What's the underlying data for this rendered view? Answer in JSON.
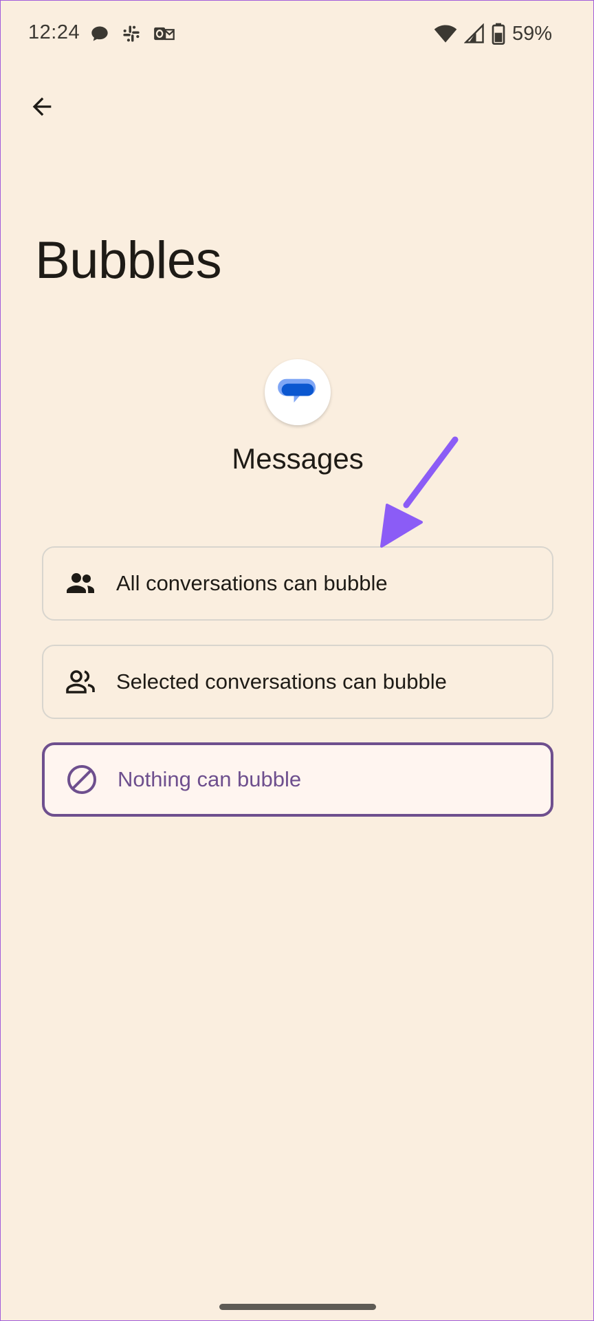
{
  "status_bar": {
    "time": "12:24",
    "battery": "59%",
    "icons": [
      "chat-notification-icon",
      "slack-icon",
      "outlook-icon",
      "wifi-icon",
      "cell-signal-icon",
      "battery-icon"
    ]
  },
  "header": {
    "back_icon": "arrow-back-icon",
    "title": "Bubbles"
  },
  "app": {
    "name": "Messages",
    "icon": "google-messages-icon"
  },
  "options": [
    {
      "label": "All conversations can bubble",
      "icon": "people-filled-icon",
      "selected": false
    },
    {
      "label": "Selected conversations can bubble",
      "icon": "people-outline-icon",
      "selected": false
    },
    {
      "label": "Nothing can bubble",
      "icon": "block-icon",
      "selected": true
    }
  ],
  "colors": {
    "background": "#FAEEDF",
    "accent": "#6E4F8E",
    "annotation": "#8B5CF6",
    "border": "#D8D5CE"
  }
}
